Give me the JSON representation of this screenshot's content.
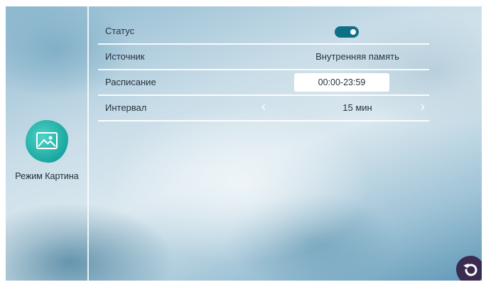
{
  "mode": {
    "label": "Режим Картина",
    "icon": "picture-icon"
  },
  "settings": {
    "status": {
      "label": "Статус",
      "enabled": true
    },
    "source": {
      "label": "Источник",
      "value": "Внутренняя память"
    },
    "schedule": {
      "label": "Расписание",
      "value": "00:00-23:59"
    },
    "interval": {
      "label": "Интервал",
      "value": "15 мин",
      "prev_icon": "chevron-left-icon",
      "next_icon": "chevron-right-icon"
    }
  },
  "controls": {
    "back_icon": "back-arrow-icon"
  },
  "colors": {
    "toggle_on": "#0f6f86",
    "mode_icon": "#1aa79f",
    "back_button": "#3a2b4f"
  }
}
